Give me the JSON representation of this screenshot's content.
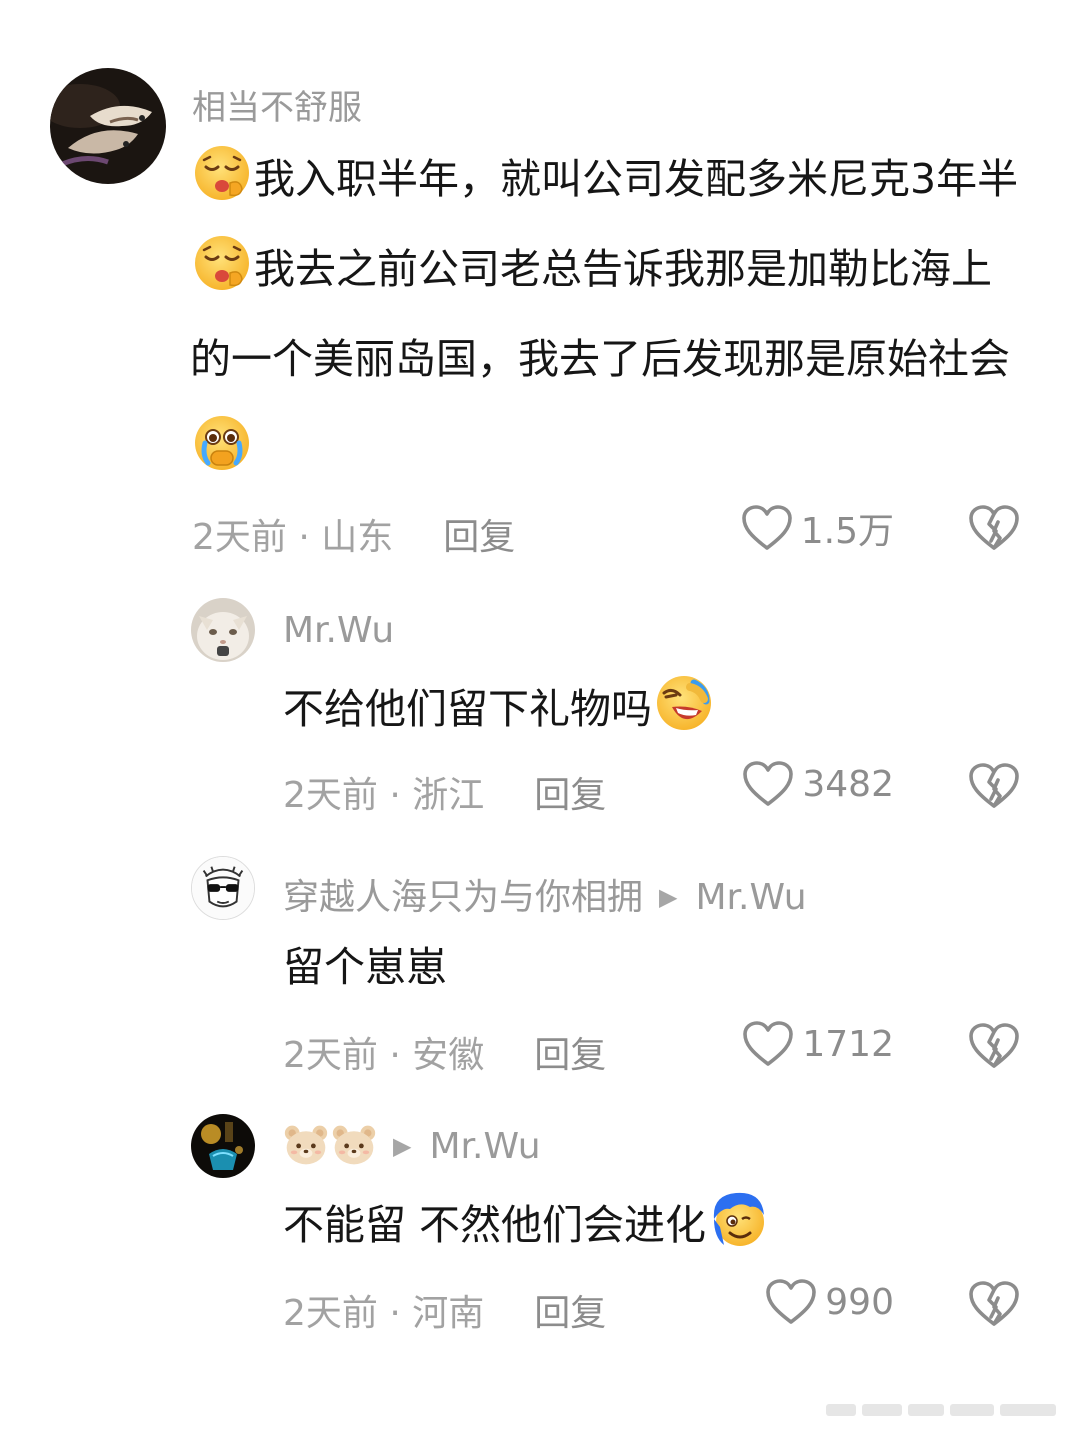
{
  "comments": [
    {
      "username": "相当不舒服",
      "text_parts": [
        "",
        "我入职半年，就叫公司发配多米尼克3年半",
        "我去之前公司老总告诉我那是加勒比海上的一个美丽岛国，我去了后发现那是原始社会",
        ""
      ],
      "emoji_names": [
        "sleepy-yawn-emoji",
        "sleepy-yawn-emoji",
        "crying-pleading-emoji"
      ],
      "time_location": "2天前 · 山东",
      "reply_label": "回复",
      "likes": "1.5万"
    },
    {
      "username": "Mr.Wu",
      "text": "不给他们留下礼物吗",
      "emoji_name": "laughing-crying-emoji",
      "time_location": "2天前 · 浙江",
      "reply_label": "回复",
      "likes": "3482"
    },
    {
      "username": "穿越人海只为与你相拥",
      "reply_to": "Mr.Wu",
      "text": "留个崽崽",
      "time_location": "2天前 · 安徽",
      "reply_label": "回复",
      "likes": "1712"
    },
    {
      "username_icons": [
        "bear-face-icon",
        "bear-face-icon"
      ],
      "reply_to": "Mr.Wu",
      "text": "不能留 不然他们会进化",
      "emoji_name": "blue-hair-grin-emoji",
      "time_location": "2天前 · 河南",
      "reply_label": "回复",
      "likes": "990"
    }
  ],
  "colors": {
    "text": "#161616",
    "meta": "#a2a2a2",
    "icon": "#8c8c8c",
    "background": "#ffffff"
  }
}
